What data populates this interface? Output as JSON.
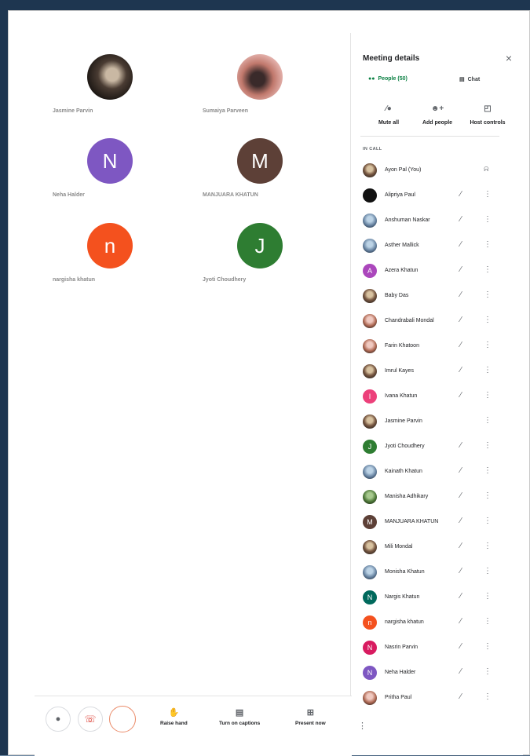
{
  "grid": [
    {
      "name": "Jasmine Parvin",
      "initial": "",
      "color": "",
      "avatar": "photo1"
    },
    {
      "name": "Sumaiya Parveen",
      "initial": "",
      "color": "",
      "avatar": "photo2"
    },
    {
      "name": "Neha Halder",
      "initial": "N",
      "color": "#7e57c2",
      "avatar": ""
    },
    {
      "name": "MANJUARA KHATUN",
      "initial": "M",
      "color": "#5d4037",
      "avatar": ""
    },
    {
      "name": "nargisha khatun",
      "initial": "n",
      "color": "#f4511e",
      "avatar": ""
    },
    {
      "name": "Jyoti Choudhery",
      "initial": "J",
      "color": "#2e7d32",
      "avatar": ""
    }
  ],
  "panel": {
    "title": "Meeting details",
    "tabs": {
      "people": "People (50)",
      "chat": "Chat"
    },
    "actions": {
      "mute_all": "Mute all",
      "add_people": "Add people",
      "host_controls": "Host controls"
    },
    "section_label": "IN CALL"
  },
  "participants": [
    {
      "name": "Ayon Pal (You)",
      "initial": "",
      "color": "",
      "avatar": "img-av",
      "self": true
    },
    {
      "name": "Alipriya Paul",
      "initial": "",
      "color": "",
      "avatar": "black-av",
      "self": false
    },
    {
      "name": "Anshuman Naskar",
      "initial": "",
      "color": "",
      "avatar": "img-av3",
      "self": false
    },
    {
      "name": "Asther Mallick",
      "initial": "",
      "color": "",
      "avatar": "img-av3",
      "self": false
    },
    {
      "name": "Azera Khatun",
      "initial": "A",
      "color": "#ab47bc",
      "avatar": "",
      "self": false
    },
    {
      "name": "Baby Das",
      "initial": "",
      "color": "",
      "avatar": "img-av",
      "self": false
    },
    {
      "name": "Chandrabali Mondal",
      "initial": "",
      "color": "",
      "avatar": "img-av2",
      "self": false
    },
    {
      "name": "Farin Khatoon",
      "initial": "",
      "color": "",
      "avatar": "img-av2",
      "self": false
    },
    {
      "name": "Imrul Kayes",
      "initial": "",
      "color": "",
      "avatar": "img-av",
      "self": false
    },
    {
      "name": "Ivana Khatun",
      "initial": "I",
      "color": "#ec407a",
      "avatar": "",
      "self": false
    },
    {
      "name": "Jasmine Parvin",
      "initial": "",
      "color": "",
      "avatar": "img-av",
      "self": false,
      "no_mute": true
    },
    {
      "name": "Jyoti Choudhery",
      "initial": "J",
      "color": "#2e7d32",
      "avatar": "",
      "self": false
    },
    {
      "name": "Kainath Khatun",
      "initial": "",
      "color": "",
      "avatar": "img-av3",
      "self": false
    },
    {
      "name": "Manisha Adhikary",
      "initial": "",
      "color": "",
      "avatar": "img-av4",
      "self": false
    },
    {
      "name": "MANJUARA KHATUN",
      "initial": "M",
      "color": "#5d4037",
      "avatar": "",
      "self": false
    },
    {
      "name": "Mili Mondal",
      "initial": "",
      "color": "",
      "avatar": "img-av",
      "self": false
    },
    {
      "name": "Monisha Khatun",
      "initial": "",
      "color": "",
      "avatar": "img-av3",
      "self": false
    },
    {
      "name": "Nargis Khatun",
      "initial": "N",
      "color": "#00695c",
      "avatar": "",
      "self": false
    },
    {
      "name": "nargisha khatun",
      "initial": "n",
      "color": "#f4511e",
      "avatar": "",
      "self": false
    },
    {
      "name": "Nasrin Parvin",
      "initial": "N",
      "color": "#d81b60",
      "avatar": "",
      "self": false
    },
    {
      "name": "Neha Halder",
      "initial": "N",
      "color": "#7e57c2",
      "avatar": "",
      "self": false
    },
    {
      "name": "Pritha Paul",
      "initial": "",
      "color": "",
      "avatar": "img-av2",
      "self": false
    }
  ],
  "bottom": {
    "raise_hand": "Raise hand",
    "captions": "Turn on captions",
    "present": "Present now"
  },
  "icons": {
    "close": "×",
    "people": "👥",
    "chat": "💬",
    "mute_all": "🎙",
    "add_people": "👤+",
    "host_controls": "⚙",
    "mute": "🔇",
    "more": "⋮",
    "bell": "🔔",
    "mic": "🎤",
    "end_call": "☎",
    "raise_hand": "✋",
    "captions": "▤",
    "present": "⊞"
  }
}
